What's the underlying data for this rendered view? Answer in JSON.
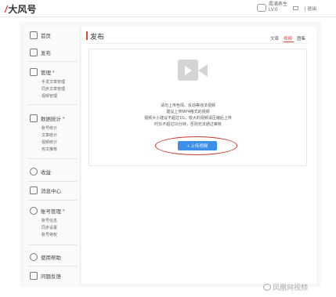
{
  "header": {
    "logo_mark": "/",
    "logo_text": "大风号",
    "user_name": "霞浦养生",
    "user_level": "LV.0",
    "logout": "| 退出"
  },
  "sidebar": {
    "home": "首页",
    "publish": "发布",
    "manage": "管理",
    "manage_items": [
      "· 手发文章管理",
      "· 同步文章管理",
      "· 视频管理"
    ],
    "stats": "数据统计",
    "stats_items": [
      "· 账号统计",
      "· 文章统计",
      "· 视频统计",
      "· 热文推荐"
    ],
    "income": "收益",
    "messages": "消息中心",
    "account": "账号管理",
    "account_items": [
      "· 账号信息",
      "· 同步设置",
      "· 账号特权"
    ],
    "help": "使用帮助",
    "feedback": "问题反馈"
  },
  "main": {
    "title": "发布",
    "tabs": [
      "文章",
      "视频",
      "图集"
    ],
    "active_tab": "视频",
    "hints": [
      "请勿上传色情、反动等违法视频",
      "建议上传MP4格式的视频",
      "视频大小建议不超过1G，较大的视频请压缩后上传",
      "时长不超过15分钟，否则无法通过审核"
    ],
    "upload_button": "+ 上传视频"
  },
  "watermark": "凤凰网视频",
  "colors": {
    "accent": "#e0463a",
    "button": "#3d8ee8",
    "annotation": "#c8362c"
  }
}
